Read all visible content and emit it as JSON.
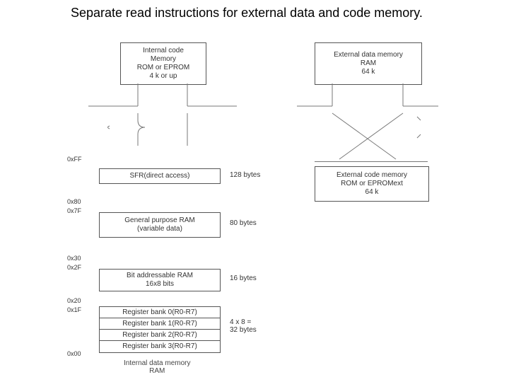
{
  "title": "Separate read instructions for external data and code memory.",
  "top": {
    "internal_code": "Internal code\nMemory\nROM or EPROM\n4 k or up",
    "external_data": "External data memory\nRAM\n64 k"
  },
  "addr": {
    "FF": "0xFF",
    "a80": "0x80",
    "a7F": "0x7F",
    "a30": "0x30",
    "a2F": "0x2F",
    "a20": "0x20",
    "a1F": "0x1F",
    "a00": "0x00"
  },
  "rows": {
    "sfr": "SFR(direct access)",
    "sfr_bytes": "128 bytes",
    "gpram1": "General purpose RAM",
    "gpram2": "(variable data)",
    "gpram_bytes": "80 bytes",
    "bitram": "Bit addressable RAM",
    "bitram2": "16x8 bits",
    "bitram_bytes": "16 bytes",
    "bank0": "Register bank 0(R0-R7)",
    "bank1": "Register bank 1(R0-R7)",
    "bank2": "Register bank 2(R0-R7)",
    "bank3": "Register bank 3(R0-R7)",
    "banks_bytes": "4 x 8 =\n32 bytes",
    "idm": "Internal data memory\nRAM"
  },
  "right": {
    "external_code": "External code memory\nROM or EPROMext\n64 k"
  }
}
